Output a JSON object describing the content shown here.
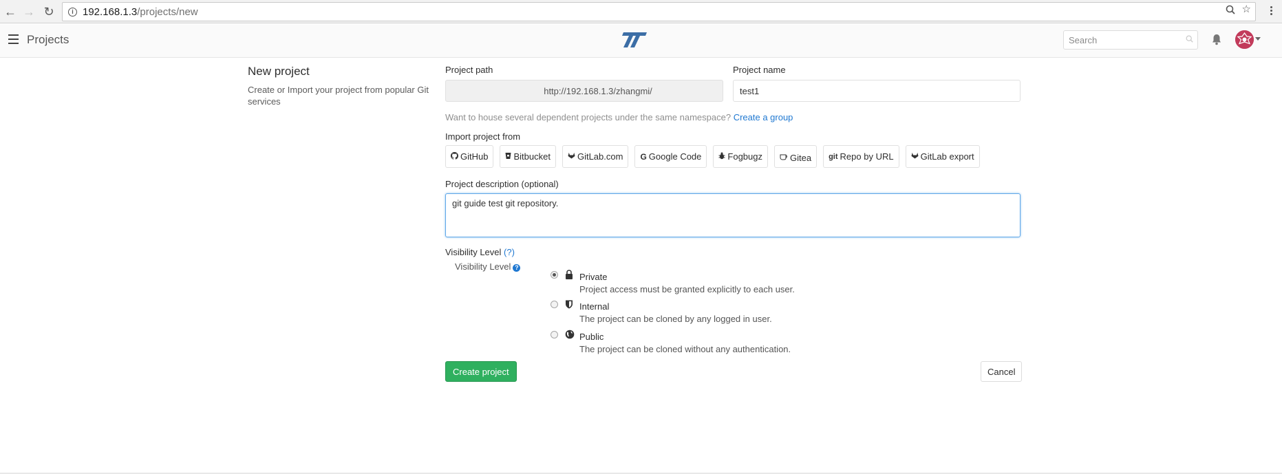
{
  "browser": {
    "url_host": "192.168.1.3",
    "url_path": "/projects/new"
  },
  "header": {
    "title": "Projects",
    "search_placeholder": "Search"
  },
  "left": {
    "title": "New project",
    "description": "Create or Import your project from popular Git services"
  },
  "form": {
    "path_label": "Project path",
    "path_value": "http://192.168.1.3/zhangmi/",
    "name_label": "Project name",
    "name_value": "test1",
    "namespace_hint": "Want to house several dependent projects under the same namespace?",
    "create_group_link": "Create a group",
    "import_label": "Import project from",
    "import_sources": [
      {
        "label": "GitHub",
        "icon": "github-icon"
      },
      {
        "label": "Bitbucket",
        "icon": "bitbucket-icon"
      },
      {
        "label": "GitLab.com",
        "icon": "gitlab-icon"
      },
      {
        "label": "Google Code",
        "icon": "google-icon"
      },
      {
        "label": "Fogbugz",
        "icon": "bug-icon"
      },
      {
        "label": "Gitea",
        "icon": "gitea-icon"
      },
      {
        "label": "Repo by URL",
        "icon": "git-icon"
      },
      {
        "label": "GitLab export",
        "icon": "gitlab-icon"
      }
    ],
    "description_label": "Project description (optional)",
    "description_value": "git guide test git repository.",
    "visibility_label": "Visibility Level",
    "visibility_help": "(?)",
    "visibility_sublabel": "Visibility Level",
    "visibility_options": [
      {
        "title": "Private",
        "desc": "Project access must be granted explicitly to each user.",
        "icon": "lock-icon",
        "checked": true
      },
      {
        "title": "Internal",
        "desc": "The project can be cloned by any logged in user.",
        "icon": "shield-icon",
        "checked": false
      },
      {
        "title": "Public",
        "desc": "The project can be cloned without any authentication.",
        "icon": "globe-icon",
        "checked": false
      }
    ],
    "create_label": "Create project",
    "cancel_label": "Cancel"
  },
  "colors": {
    "primary_button": "#2fb05f",
    "link": "#1f78d1",
    "logo": "#3c6ea6"
  }
}
